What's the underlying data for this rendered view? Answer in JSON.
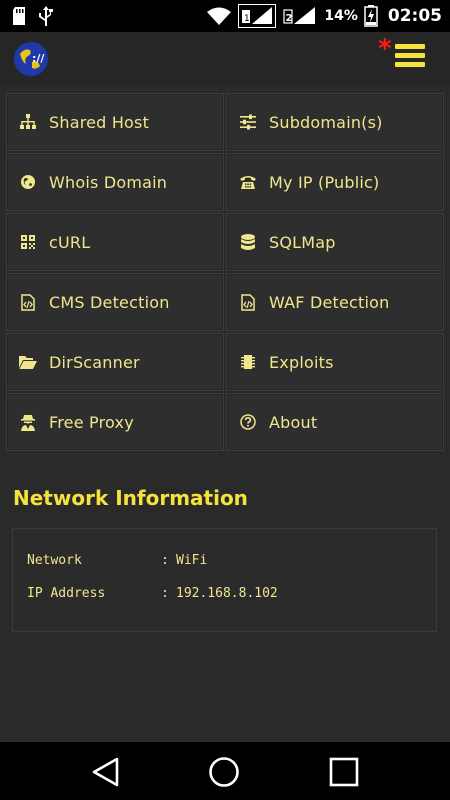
{
  "status_bar": {
    "battery_percent": "14%",
    "time": "02:05",
    "sim1_label": "1",
    "sim2_label": "2"
  },
  "app_bar": {
    "logo_text": "://",
    "menu_badge": "*"
  },
  "menu": {
    "items": [
      {
        "label": "Shared Host",
        "icon": "sitemap-icon"
      },
      {
        "label": "Subdomain(s)",
        "icon": "sliders-icon"
      },
      {
        "label": "Whois Domain",
        "icon": "globe-icon"
      },
      {
        "label": "My IP (Public)",
        "icon": "phone-icon"
      },
      {
        "label": "cURL",
        "icon": "qrcode-icon"
      },
      {
        "label": "SQLMap",
        "icon": "database-icon"
      },
      {
        "label": "CMS Detection",
        "icon": "code-file-icon"
      },
      {
        "label": "WAF Detection",
        "icon": "code-file-icon"
      },
      {
        "label": "DirScanner",
        "icon": "folder-open-icon"
      },
      {
        "label": "Exploits",
        "icon": "chip-icon"
      },
      {
        "label": "Free Proxy",
        "icon": "user-secret-icon"
      },
      {
        "label": "About",
        "icon": "question-circle-icon"
      }
    ]
  },
  "network": {
    "title": "Network Information",
    "rows": [
      {
        "key": "Network",
        "sep": ":",
        "value": "WiFi"
      },
      {
        "key": "IP Address",
        "sep": ":",
        "value": "192.168.8.102"
      }
    ]
  },
  "colors": {
    "accent": "#f5e33c",
    "label": "#f0e68c",
    "badge": "#ff1a1a",
    "background": "#2a2a2a"
  }
}
